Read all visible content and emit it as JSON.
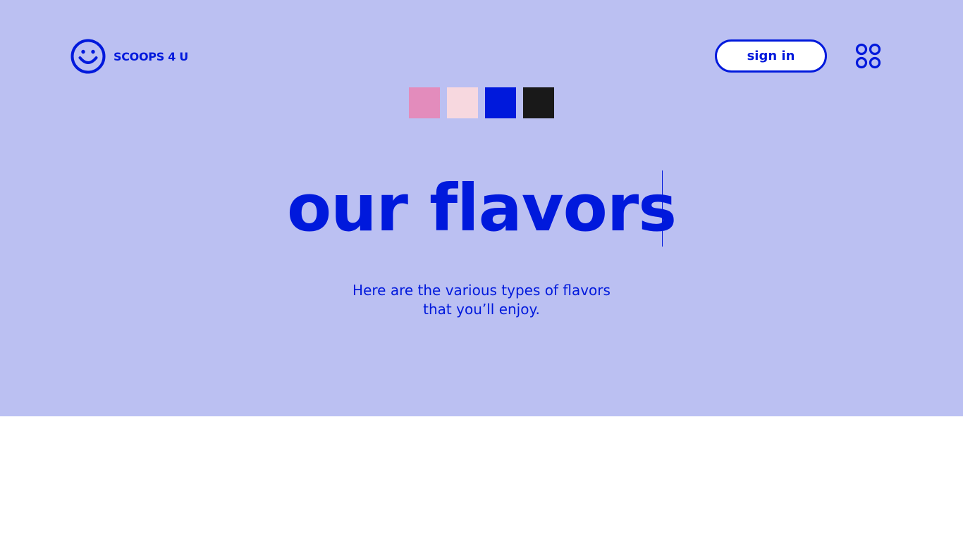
{
  "brand": {
    "name": "SCOOPS 4 U",
    "logo_icon": "smiley-face-icon"
  },
  "header": {
    "signin_label": "sign in",
    "menu_icon": "four-circles-menu-icon"
  },
  "swatches": [
    {
      "color": "#e38cbc"
    },
    {
      "color": "#f7d8df"
    },
    {
      "color": "#0019dc"
    },
    {
      "color": "#191919"
    }
  ],
  "hero": {
    "title": "our flavors",
    "subtitle_line1": "Here are the various types of flavors",
    "subtitle_line2": "that you’ll enjoy."
  },
  "colors": {
    "accent": "#0019dc",
    "hero_background": "#bbc0f2",
    "page_background": "#ffffff"
  }
}
